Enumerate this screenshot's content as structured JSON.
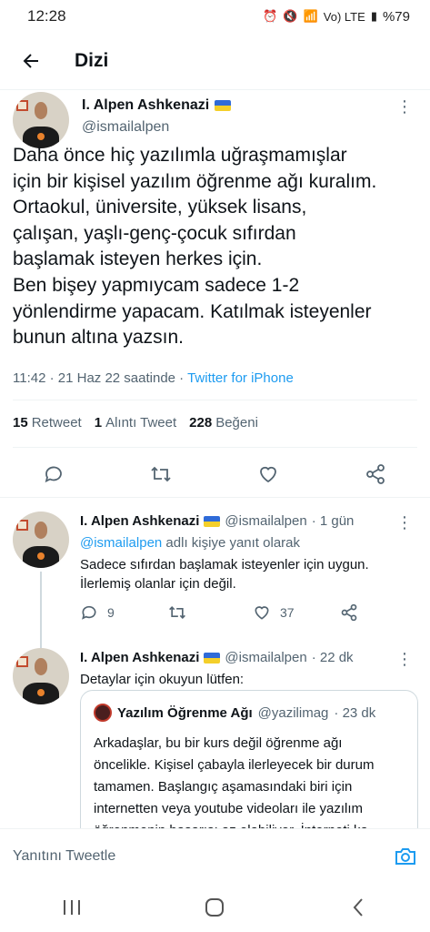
{
  "status_bar": {
    "time": "12:28",
    "network": "Vo) LTE",
    "battery": "%79"
  },
  "header": {
    "title": "Dizi"
  },
  "main_tweet": {
    "author_name": "I. Alpen Ashkenazi",
    "handle": "@ismailalpen",
    "text": "Daha önce hiç yazılımla uğraşmamışlar\niçin bir kişisel yazılım öğrenme ağı kuralım.\nOrtaokul, üniversite, yüksek lisans,\nçalışan, yaşlı-genç-çocuk sıfırdan\nbaşlamak isteyen herkes için.\nBen bişey yapmıycam sadece 1-2\nyönlendirme yapacam. Katılmak isteyenler\nbunun altına yazsın.",
    "meta_time": "11:42 · 21 Haz 22 saatinde · ",
    "meta_source": "Twitter for iPhone",
    "retweets": "15",
    "retweets_label": "Retweet",
    "quotes": "1",
    "quotes_label": "Alıntı Tweet",
    "likes": "228",
    "likes_label": "Beğeni"
  },
  "replies": [
    {
      "author_name": "I. Alpen Ashkenazi",
      "handle": "@ismailalpen",
      "time": "· 1 gün",
      "reply_to_handle": "@ismailalpen",
      "reply_to_suffix": " adlı kişiye yanıt olarak",
      "text": "Sadece sıfırdan başlamak isteyenler için uygun.\nİlerlemiş olanlar için değil.",
      "reply_count": "9",
      "retweet_count": "",
      "like_count": "37"
    },
    {
      "author_name": "I. Alpen Ashkenazi",
      "handle": "@ismailalpen",
      "time": "· 22 dk",
      "text": "Detaylar için okuyun lütfen:",
      "quote": {
        "author_name": "Yazılım Öğrenme Ağı",
        "handle": "@yazilimag",
        "time": "· 23 dk",
        "text": "Arkadaşlar, bu bir kurs değil öğrenme ağı\nöncelikle. Kişisel çabayla ilerleyecek bir durum\ntamamen. Başlangıç aşamasındaki biri için\ninternetten veya youtube videoları ile yazılım\nöğrenmenin başarısı az olabiliyor. İnterneti ka..."
      }
    }
  ],
  "compose": {
    "placeholder": "Yanıtını Tweetle"
  },
  "icons": {
    "back": "arrow-left-icon",
    "reply": "comment-icon",
    "retweet": "retweet-icon",
    "like": "heart-icon",
    "share": "share-icon",
    "camera": "camera-icon"
  },
  "colors": {
    "accent": "#1d9bf0",
    "secondary_text": "#536471",
    "text": "#0f1419"
  }
}
